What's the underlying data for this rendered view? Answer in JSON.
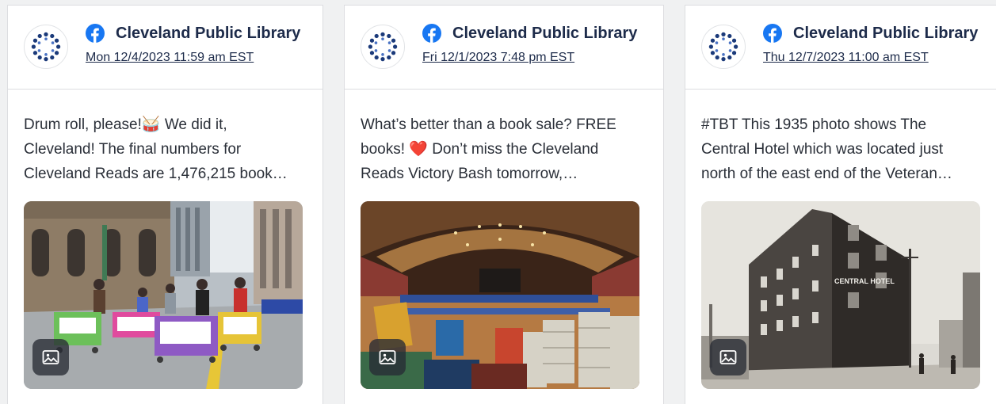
{
  "colors": {
    "facebook_blue": "#1877f2",
    "logo_blue": "#1b3a7a",
    "text_dark": "#1d2b4a",
    "heart_red": "#e0245e"
  },
  "posts": [
    {
      "page_name": "Cleveland Public Library",
      "date": "Mon 12/4/2023 11:59 am EST",
      "text_lines": [
        "Drum roll, please!🥁 We did it,",
        "Cleveland! The final numbers for",
        "Cleveland Reads are 1,476,215 book…"
      ],
      "image_icon": "image-icon",
      "image_description": "parade-photo"
    },
    {
      "page_name": "Cleveland Public Library",
      "date": "Fri 12/1/2023 7:48 pm EST",
      "text_lines": [
        "What’s better than a book sale? FREE",
        "books! ❤️ Don’t miss the Cleveland",
        "Reads Victory Bash tomorrow,…"
      ],
      "image_icon": "image-icon",
      "image_description": "book-sale-hall-photo"
    },
    {
      "page_name": "Cleveland Public Library",
      "date": "Thu 12/7/2023 11:00 am EST",
      "text_lines": [
        "#TBT This 1935 photo shows The",
        "Central Hotel which was located just",
        "north of the east end of the Veteran…"
      ],
      "image_icon": "image-icon",
      "image_description": "central-hotel-photo",
      "image_sign": "CENTRAL HOTEL"
    }
  ]
}
